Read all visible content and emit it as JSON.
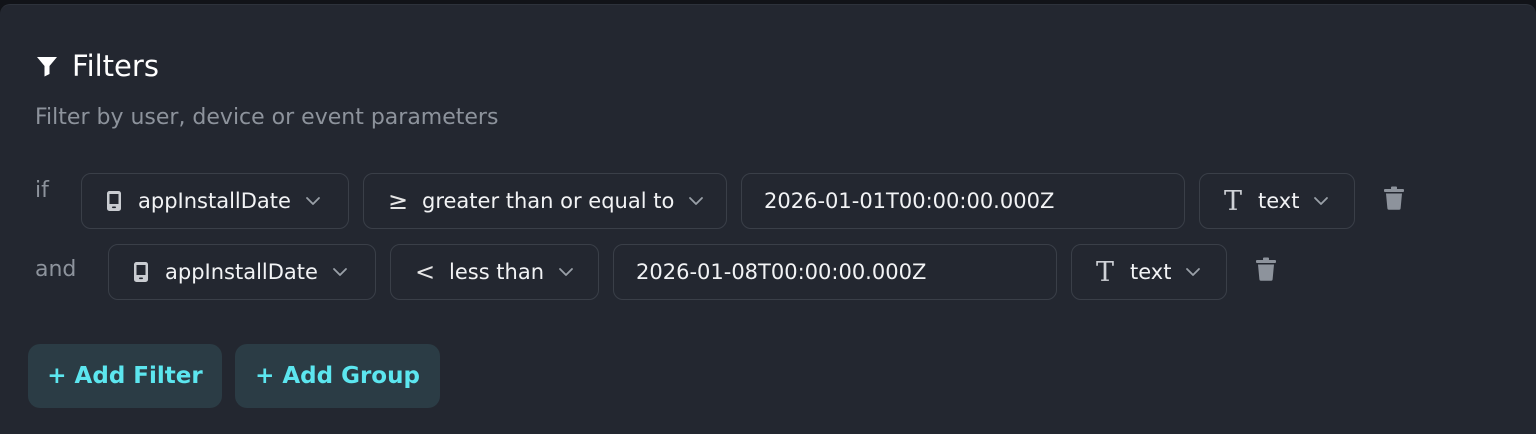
{
  "header": {
    "icon": "filter-icon",
    "title": "Filters",
    "subtitle": "Filter by user, device or event parameters"
  },
  "filters": [
    {
      "connector": "if",
      "field": {
        "icon": "device-icon",
        "label": "appInstallDate"
      },
      "operator": {
        "symbol": "≥",
        "label": "greater than or equal to"
      },
      "value": "2026-01-01T00:00:00.000Z",
      "value_type": {
        "icon": "text-type-icon",
        "label": "text"
      },
      "delete_icon": "trash-icon"
    },
    {
      "connector": "and",
      "field": {
        "icon": "device-icon",
        "label": "appInstallDate"
      },
      "operator": {
        "symbol": "<",
        "label": "less than"
      },
      "value": "2026-01-08T00:00:00.000Z",
      "value_type": {
        "icon": "text-type-icon",
        "label": "text"
      },
      "delete_icon": "trash-icon"
    }
  ],
  "actions": {
    "add_filter_label": "+ Add Filter",
    "add_group_label": "+ Add Group"
  },
  "colors": {
    "panel_bg": "#232730",
    "border": "#3a3f48",
    "accent": "#5ce6ef",
    "button_bg": "#2b3c45",
    "muted_text": "#8d939c"
  }
}
